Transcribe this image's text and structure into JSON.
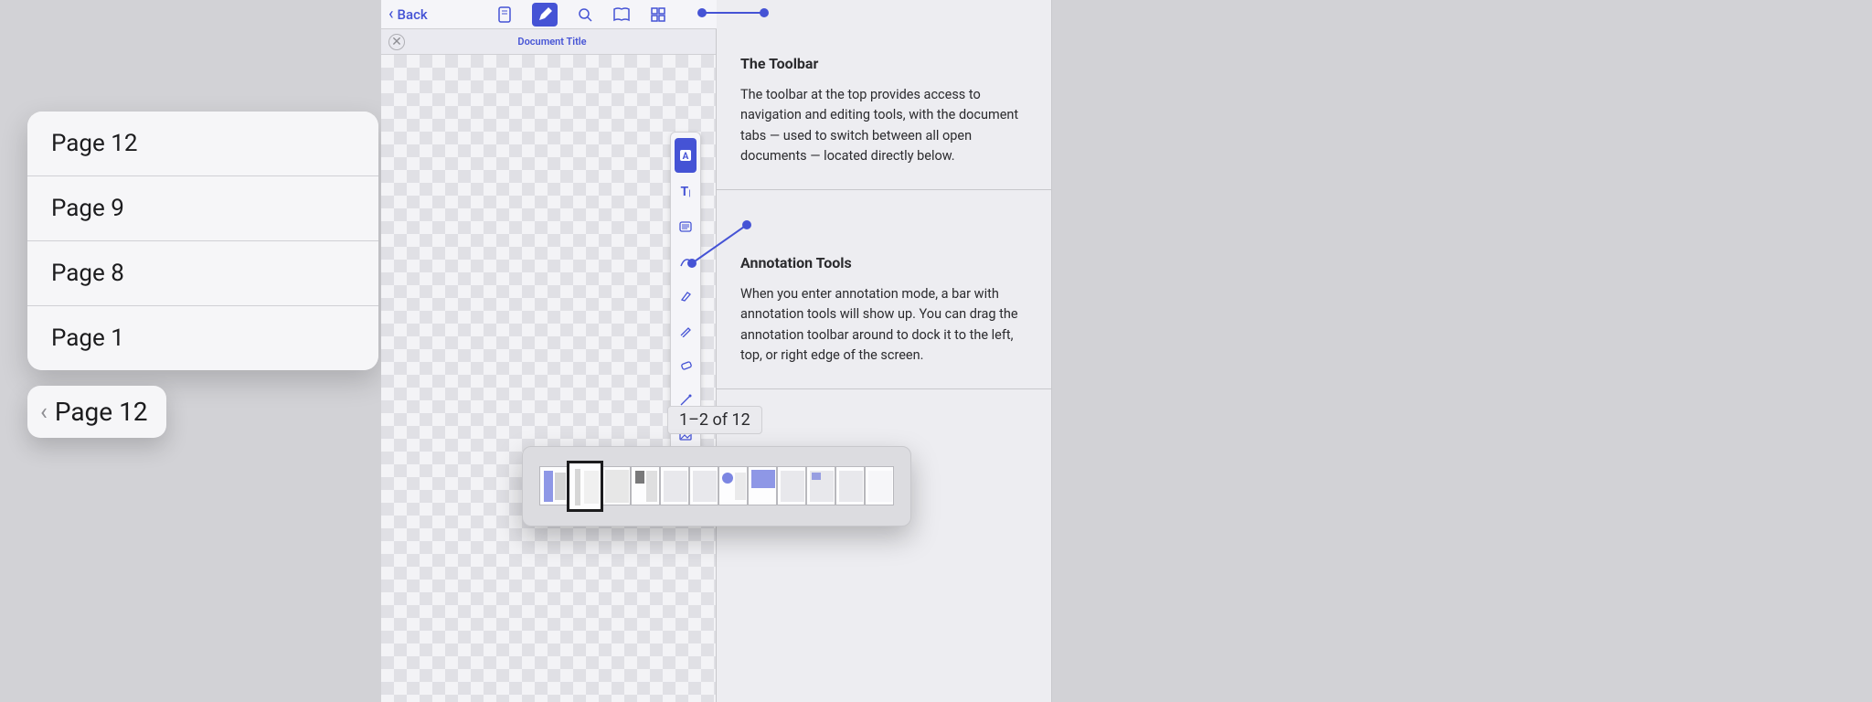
{
  "history_popover": {
    "items": [
      {
        "label": "Page 12"
      },
      {
        "label": "Page 9"
      },
      {
        "label": "Page 8"
      },
      {
        "label": "Page 1"
      }
    ]
  },
  "breadcrumb": {
    "label": "Page 12"
  },
  "toolbar": {
    "back_label": "Back",
    "tab_title": "Document Title"
  },
  "content": {
    "section1": {
      "heading": "The Toolbar",
      "body": "The toolbar at the top provides access to navigation and editing tools, with the document tabs — used to switch between all open documents — located directly below."
    },
    "section2": {
      "heading": "Annotation Tools",
      "body": "When you enter annotation mode, a bar with annotation tools will show up. You can drag the annotation toolbar around to dock it to the left, top, or right edge of the screen."
    }
  },
  "page_indicator": {
    "text": "1–2 of 12"
  },
  "thumbnails": {
    "count": 12,
    "current_index": 1
  },
  "colors": {
    "accent": "#4553d5"
  }
}
